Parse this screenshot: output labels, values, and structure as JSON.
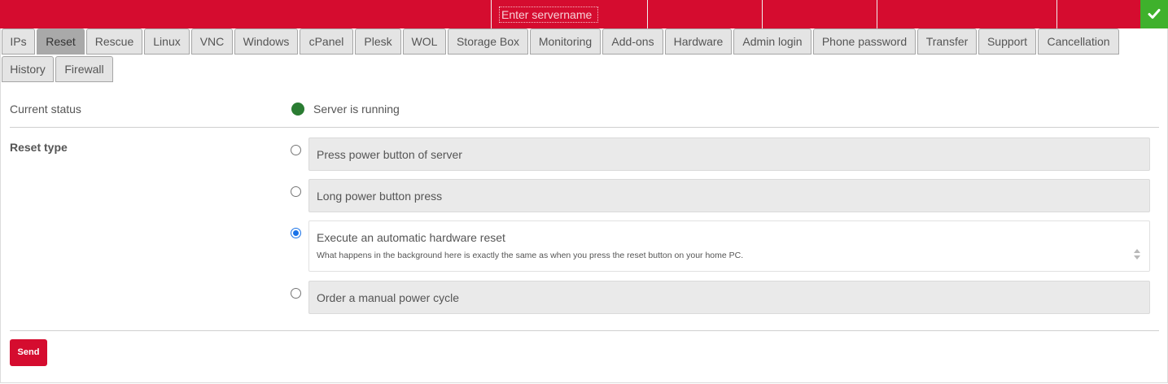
{
  "header": {
    "server_input_placeholder": "Enter servername",
    "brand_color": "#d50c2f",
    "confirm_color": "#3fb12c",
    "confirm_icon": "check-icon"
  },
  "tabs": [
    {
      "label": "IPs",
      "active": false
    },
    {
      "label": "Reset",
      "active": true
    },
    {
      "label": "Rescue",
      "active": false
    },
    {
      "label": "Linux",
      "active": false
    },
    {
      "label": "VNC",
      "active": false
    },
    {
      "label": "Windows",
      "active": false
    },
    {
      "label": "cPanel",
      "active": false
    },
    {
      "label": "Plesk",
      "active": false
    },
    {
      "label": "WOL",
      "active": false
    },
    {
      "label": "Storage Box",
      "active": false
    },
    {
      "label": "Monitoring",
      "active": false
    },
    {
      "label": "Add-ons",
      "active": false
    },
    {
      "label": "Hardware",
      "active": false
    },
    {
      "label": "Admin login",
      "active": false
    },
    {
      "label": "Phone password",
      "active": false
    },
    {
      "label": "Transfer",
      "active": false
    },
    {
      "label": "Support",
      "active": false
    },
    {
      "label": "Cancellation",
      "active": false
    },
    {
      "label": "History",
      "active": false
    },
    {
      "label": "Firewall",
      "active": false
    }
  ],
  "status": {
    "label": "Current status",
    "text": "Server is running",
    "color": "#2a7c32"
  },
  "reset_type": {
    "label": "Reset type",
    "options": [
      {
        "title": "Press power button of server",
        "selected": false
      },
      {
        "title": "Long power button press",
        "selected": false
      },
      {
        "title": "Execute an automatic hardware reset",
        "description": "What happens in the background here is exactly the same as when you press the reset button on your home PC.",
        "selected": true
      },
      {
        "title": "Order a manual power cycle",
        "selected": false
      }
    ]
  },
  "send_label": "Send"
}
